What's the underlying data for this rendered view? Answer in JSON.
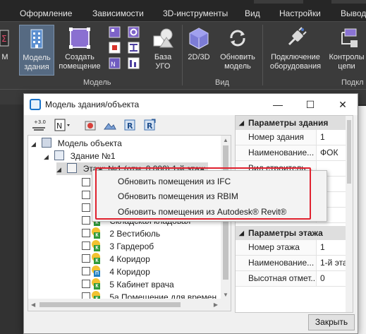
{
  "ribbon": {
    "tabs": [
      "Оформление",
      "Зависимости",
      "3D-инструменты",
      "Вид",
      "Настройки",
      "Вывод"
    ],
    "buttons": {
      "left_partial": "M",
      "building_model": [
        "Модель",
        "здания"
      ],
      "create_room": [
        "Создать",
        "помещение"
      ],
      "ugo_base": [
        "База",
        "УГО"
      ],
      "view_2d3d": "2D/3D",
      "update_model": [
        "Обновить",
        "модель"
      ],
      "equipment_connection": [
        "Подключение",
        "оборудования"
      ],
      "control_circuits": [
        "Контролы",
        "цепи"
      ]
    },
    "groups": {
      "model": "Модель",
      "view": "Вид",
      "connections": "Подкл"
    }
  },
  "dialog": {
    "title": "Модель здания/объекта",
    "toolbar": {
      "numbering_label": "+3.0"
    },
    "tree": {
      "root": "Модель объекта",
      "building": "Здание №1",
      "floor": "Этаж: №1 (отм. 0.000) 1-й этаж",
      "rooms": [
        "Складская кладовая",
        "2 Вестибюль",
        "3 Гардероб",
        "4 Коридор",
        "4 Коридор",
        "5 Кабинет врача",
        "5а Помещение для времен"
      ]
    },
    "properties": {
      "building_section": "Параметры здания",
      "building_rows": [
        {
          "name": "Номер здания",
          "value": "1"
        },
        {
          "name": "Наименование...",
          "value": "ФОК"
        },
        {
          "name": "Вид строитель...",
          "value": ""
        }
      ],
      "floor_section": "Параметры этажа",
      "floor_rows": [
        {
          "name": "Номер этажа",
          "value": "1"
        },
        {
          "name": "Наименование...",
          "value": "1-й этаж"
        },
        {
          "name": "Высотная отмет...",
          "value": "0"
        }
      ]
    },
    "close_label": "Закрыть"
  },
  "context_menu": {
    "items": [
      "Обновить помещения из IFC",
      "Обновить помещения из RBIM",
      "Обновить помещения из Autodesk® Revit®"
    ]
  },
  "colors": {
    "highlight": "#e0212e",
    "ribbon_bg": "#3b3b3b",
    "active_button": "#566a82"
  }
}
